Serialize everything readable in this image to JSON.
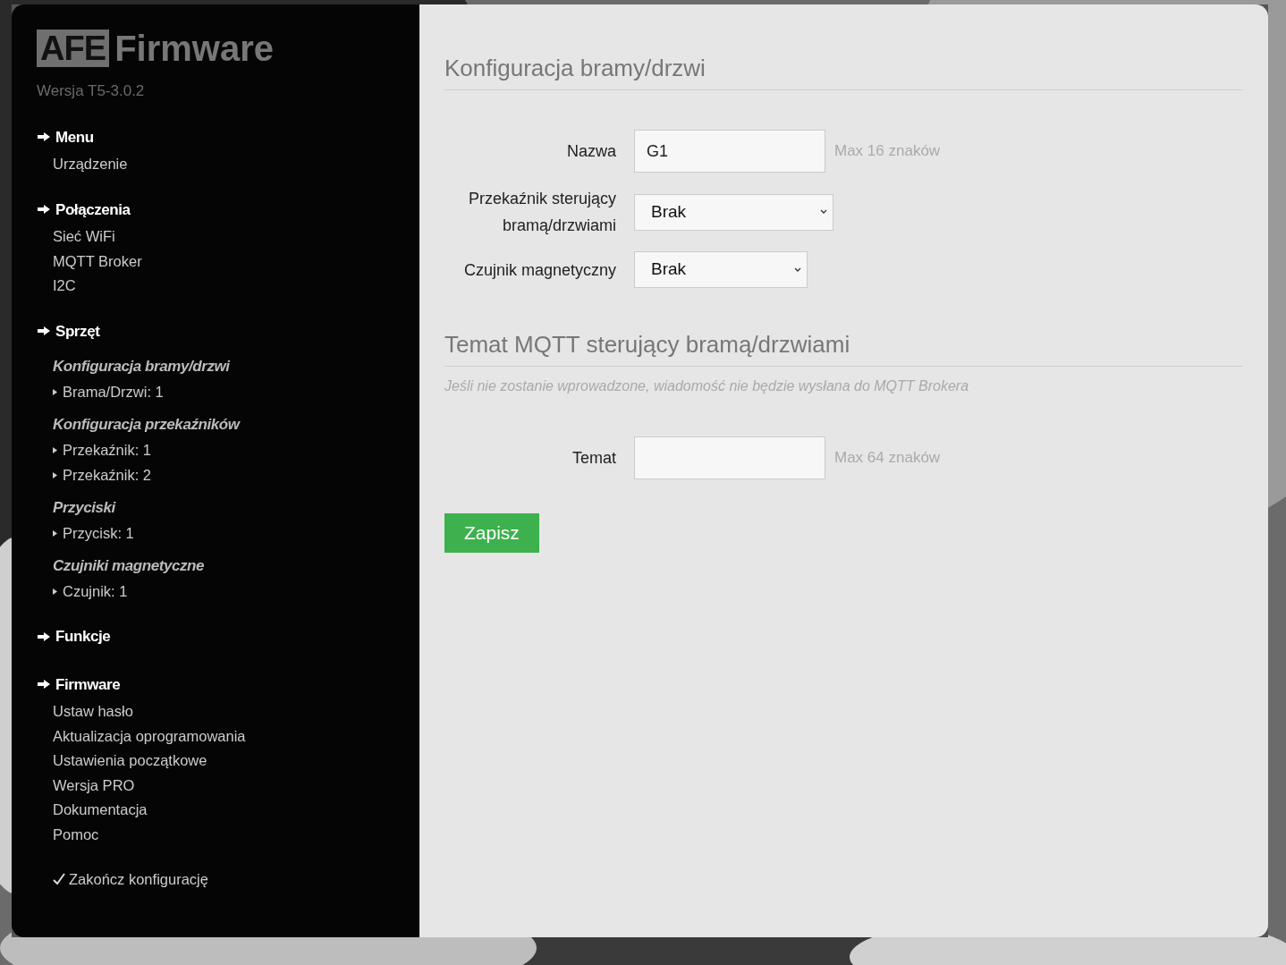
{
  "sidebar": {
    "logo": {
      "badge": "AFE",
      "text": "Firmware"
    },
    "version": "Wersja T5-3.0.2",
    "sections": [
      {
        "title": "Menu",
        "items": [
          {
            "kind": "link",
            "label": "Urządzenie"
          }
        ]
      },
      {
        "title": "Połączenia",
        "items": [
          {
            "kind": "link",
            "label": "Sieć WiFi"
          },
          {
            "kind": "link",
            "label": "MQTT Broker"
          },
          {
            "kind": "link",
            "label": "I2C"
          }
        ]
      },
      {
        "title": "Sprzęt",
        "items": [
          {
            "kind": "group",
            "label": "Konfiguracja bramy/drzwi",
            "children": [
              {
                "label": "Brama/Drzwi: 1"
              }
            ]
          },
          {
            "kind": "group",
            "label": "Konfiguracja przekaźników",
            "children": [
              {
                "label": "Przekaźnik: 1"
              },
              {
                "label": "Przekaźnik: 2"
              }
            ]
          },
          {
            "kind": "group",
            "label": "Przyciski",
            "children": [
              {
                "label": "Przycisk: 1"
              }
            ]
          },
          {
            "kind": "group",
            "label": "Czujniki magnetyczne",
            "children": [
              {
                "label": "Czujnik: 1"
              }
            ]
          }
        ]
      },
      {
        "title": "Funkcje"
      },
      {
        "title": "Firmware",
        "items": [
          {
            "kind": "link",
            "label": "Ustaw hasło"
          },
          {
            "kind": "link",
            "label": "Aktualizacja oprogramowania"
          },
          {
            "kind": "link",
            "label": "Ustawienia początkowe"
          },
          {
            "kind": "link",
            "label": "Wersja PRO"
          },
          {
            "kind": "link",
            "label": "Dokumentacja"
          },
          {
            "kind": "link",
            "label": "Pomoc"
          }
        ]
      }
    ],
    "finish": "Zakończ konfigurację"
  },
  "main": {
    "sections": [
      {
        "title": "Konfiguracja bramy/drzwi",
        "fields": [
          {
            "kind": "text",
            "label": "Nazwa",
            "value": "G1",
            "hint": "Max 16 znaków"
          },
          {
            "kind": "select",
            "label": "Przekaźnik sterujący bramą/drzwiami",
            "value": "Brak",
            "wide": true
          },
          {
            "kind": "select",
            "label": "Czujnik magnetyczny",
            "value": "Brak",
            "wide": false
          }
        ]
      },
      {
        "title": "Temat MQTT sterujący bramą/drzwiami",
        "note": "Jeśli nie zostanie wprowadzone, wiadomość nie będzie wysłana do MQTT Brokera",
        "fields": [
          {
            "kind": "text",
            "label": "Temat",
            "hint": "Max 64 znaków"
          }
        ]
      }
    ],
    "save": "Zapisz"
  }
}
